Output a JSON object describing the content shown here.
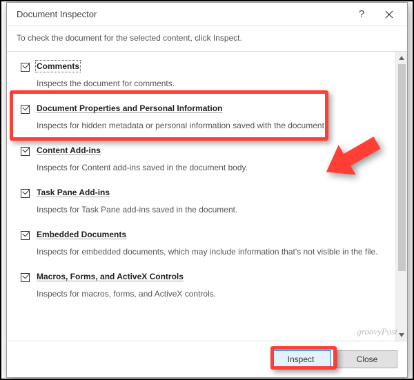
{
  "titlebar": {
    "title": "Document Inspector"
  },
  "instruction": "To check the document for the selected content, click Inspect.",
  "items": [
    {
      "label": "Comments",
      "desc": "Inspects the document for comments.",
      "checked": true,
      "focused": true
    },
    {
      "label": "Document Properties and Personal Information",
      "desc": "Inspects for hidden metadata or personal information saved with the document.",
      "checked": true,
      "focused": false
    },
    {
      "label": "Content Add-ins",
      "desc": "Inspects for Content add-ins saved in the document body.",
      "checked": true,
      "focused": false
    },
    {
      "label": "Task Pane Add-ins",
      "desc": "Inspects for Task Pane add-ins saved in the document.",
      "checked": true,
      "focused": false
    },
    {
      "label": "Embedded Documents",
      "desc": "Inspects for embedded documents, which may include information that's not visible in the file.",
      "checked": true,
      "focused": false
    },
    {
      "label": "Macros, Forms, and ActiveX Controls",
      "desc": "Inspects for macros, forms, and ActiveX controls.",
      "checked": true,
      "focused": false
    }
  ],
  "footer": {
    "inspect": "Inspect",
    "close": "Close"
  },
  "watermark": "groovyPost"
}
